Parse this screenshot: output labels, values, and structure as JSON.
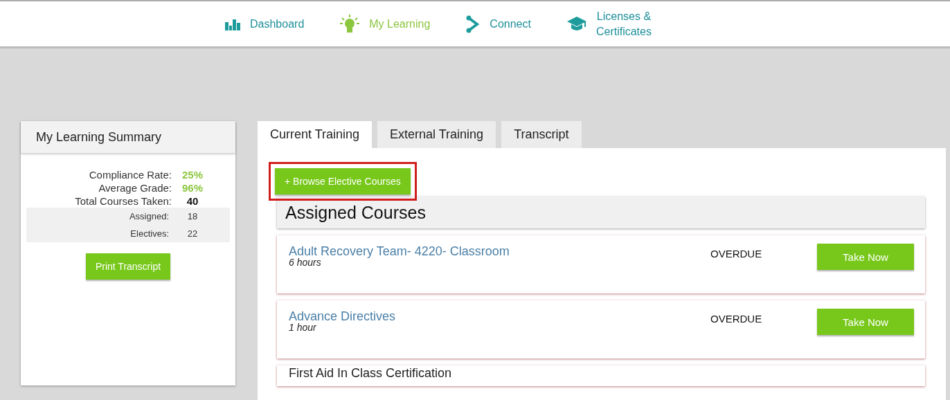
{
  "nav": [
    {
      "label": "Dashboard",
      "kind": "bars",
      "selected": false
    },
    {
      "label": "My Learning",
      "kind": "bulb",
      "selected": true
    },
    {
      "label": "Connect",
      "kind": "share",
      "selected": false
    },
    {
      "label": "Licenses &\nCertificates",
      "kind": "cap",
      "selected": false
    }
  ],
  "summary": {
    "title": "My Learning Summary",
    "stats": [
      {
        "label": "Compliance Rate:",
        "value": "25%",
        "kind": "highlight"
      },
      {
        "label": "Average Grade:",
        "value": "96%",
        "kind": "highlight"
      },
      {
        "label": "Total Courses Taken:",
        "value": "40",
        "kind": "total"
      },
      {
        "label": "Assigned:",
        "value": "18",
        "kind": "sub"
      },
      {
        "label": "Electives:",
        "value": "22",
        "kind": "sub"
      }
    ],
    "button": "Print Transcript"
  },
  "tabs": [
    {
      "label": "Current Training",
      "selected": true
    },
    {
      "label": "External Training",
      "selected": false
    },
    {
      "label": "Transcript",
      "selected": false
    }
  ],
  "browse_button": {
    "label": "+ Browse Elective Courses",
    "highlighted": true
  },
  "section_title": "Assigned Courses",
  "courses": [
    {
      "title": "Adult Recovery Team- 4220- Classroom",
      "linked": true,
      "duration": "6 hours",
      "status": "OVERDUE",
      "action": "Take Now"
    },
    {
      "title": "Advance Directives",
      "linked": true,
      "duration": "1 hour",
      "status": "OVERDUE",
      "action": "Take Now"
    },
    {
      "title": "First Aid In Class Certification",
      "linked": false
    }
  ]
}
